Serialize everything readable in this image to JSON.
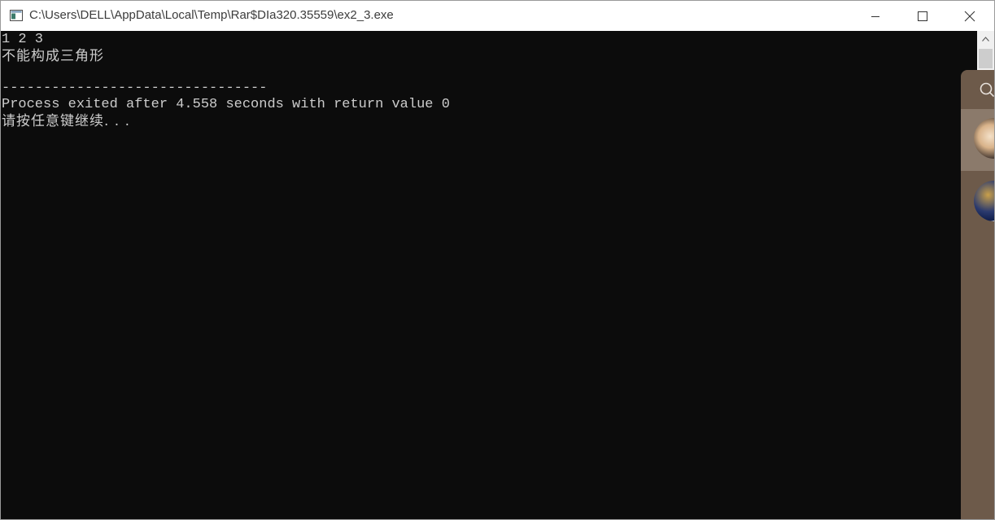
{
  "window": {
    "title": "C:\\Users\\DELL\\AppData\\Local\\Temp\\Rar$DIa320.35559\\ex2_3.exe"
  },
  "console": {
    "lines": [
      "1 2 3",
      "不能构成三角形",
      "",
      "--------------------------------",
      "Process exited after 4.558 seconds with return value 0",
      "请按任意键继续. . ."
    ]
  },
  "icons": {
    "app": "console-app-icon",
    "minimize": "minimize-icon",
    "maximize": "maximize-icon",
    "close": "close-icon",
    "scroll_up": "chevron-up-icon",
    "side_search": "search-icon"
  },
  "colors": {
    "console_bg": "#0c0c0c",
    "console_text": "#cccccc",
    "titlebar_bg": "#ffffff",
    "side_panel": "#6d5a4a"
  }
}
